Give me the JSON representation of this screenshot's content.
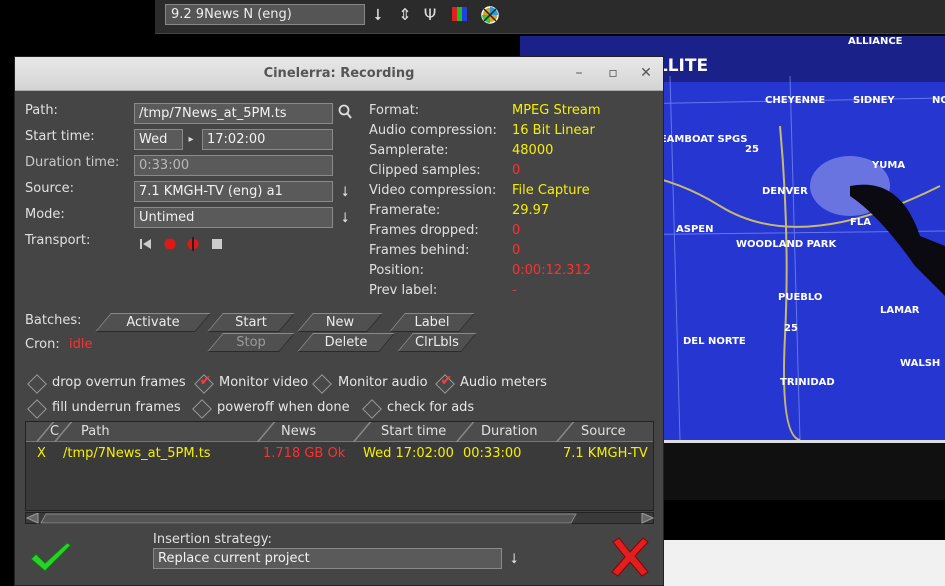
{
  "topbar": {
    "channel": "9.2 9News N (eng)",
    "icons": [
      "down-arrow-icon",
      "up-down-arrow-icon",
      "antenna-icon",
      "color-bars-icon",
      "color-wheel-icon"
    ]
  },
  "video": {
    "heading": "AR AND SATELLITE",
    "labels": [
      "ALLIANCE",
      "CHEYENNE",
      "SIDNEY",
      "NO",
      "TEAMBOAT SPGS",
      "YUMA",
      "DENVER",
      "ASPEN",
      "WOODLAND PARK",
      "FLA",
      "PUEBLO",
      "LAMAR",
      "DEL NORTE",
      "WALSH",
      "TRINIDAD",
      "25",
      "25"
    ]
  },
  "dialog": {
    "title": "Cinelerra: Recording",
    "window_buttons": [
      "minimize",
      "maximize",
      "close"
    ],
    "path_label": "Path:",
    "path_value": "/tmp/7News_at_5PM.ts",
    "start_label": "Start time:",
    "start_day": "Wed",
    "start_time": "17:02:00",
    "duration_label": "Duration time:",
    "duration_value": "0:33:00",
    "source_label": "Source:",
    "source_value": "7.1 KMGH-TV (eng) a1",
    "mode_label": "Mode:",
    "mode_value": "Untimed",
    "transport_label": "Transport:",
    "info": {
      "format_label": "Format:",
      "format_value": "MPEG Stream",
      "audio_comp_label": "Audio compression:",
      "audio_comp_value": "16 Bit Linear",
      "samplerate_label": "Samplerate:",
      "samplerate_value": "48000",
      "clipped_label": "Clipped samples:",
      "clipped_value": "0",
      "video_comp_label": "Video compression:",
      "video_comp_value": "File Capture",
      "framerate_label": "Framerate:",
      "framerate_value": "29.97",
      "dropped_label": "Frames dropped:",
      "dropped_value": "0",
      "behind_label": "Frames behind:",
      "behind_value": "0",
      "position_label": "Position:",
      "position_value": "0:00:12.312",
      "prevlabel_label": "Prev label:",
      "prevlabel_value": "-"
    },
    "batches_label": "Batches:",
    "cron_label": "Cron:",
    "cron_value": "idle",
    "buttons": {
      "activate": "Activate",
      "start": "Start",
      "new": "New",
      "label": "Label",
      "stop": "Stop",
      "delete": "Delete",
      "clrlbls": "ClrLbls"
    },
    "checks": {
      "drop_overrun": "drop overrun frames",
      "monitor_video": "Monitor video",
      "monitor_audio": "Monitor audio",
      "audio_meters": "Audio meters",
      "fill_underrun": "fill underrun frames",
      "poweroff": "poweroff when done",
      "check_ads": "check for ads"
    },
    "table": {
      "headers": [
        "C",
        "Path",
        "News",
        "Start time",
        "Duration",
        "Source"
      ],
      "rows": [
        {
          "c": "X",
          "path": "/tmp/7News_at_5PM.ts",
          "news": "1.718 GB Ok",
          "start": "Wed 17:02:00",
          "duration": "00:33:00",
          "source": "7.1 KMGH-TV"
        }
      ]
    },
    "insertion_label": "Insertion strategy:",
    "insertion_value": "Replace current project"
  },
  "colors": {
    "value_yellow": "#f6f000",
    "value_red": "#ff3030",
    "ok_green": "#2bd12b",
    "cancel_red": "#e02020"
  }
}
